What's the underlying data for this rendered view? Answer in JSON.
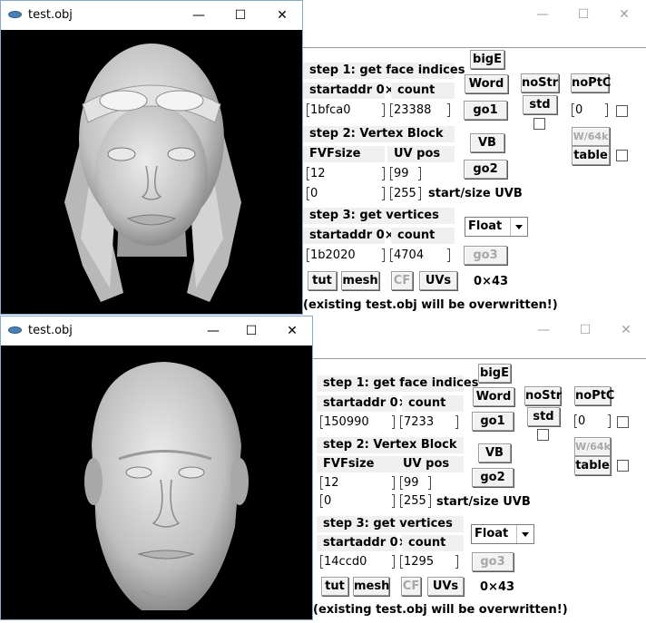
{
  "window1": {
    "viewer_title": "test.obj",
    "min": "—",
    "max": "☐",
    "close": "✕",
    "panel": {
      "min": "—",
      "max": "☐",
      "close": "✕",
      "step1": "step 1: get face indices",
      "startaddr_label": "startaddr 0×",
      "count_label": "count",
      "startaddr": "1bfca0",
      "count": "23388",
      "step2": "step 2: Vertex Block",
      "fvf_label": "FVFsize",
      "uvpos_label": "UV pos",
      "fvf": "12",
      "uvpos": "99",
      "uvstart": "0",
      "uvsize": "255",
      "uvb_label": "start/size UVB",
      "step3": "step 3: get vertices",
      "v_startaddr_label": "startaddr 0×",
      "v_count_label": "count",
      "v_startaddr": "1b2020",
      "v_count": "4704",
      "bigE": "bigE",
      "word": "Word",
      "go1": "go1",
      "vb": "VB",
      "go2": "go2",
      "go3": "go3",
      "noStr": "noStr",
      "std": "std",
      "noPtC": "noPtC",
      "w64": "W/64k",
      "table": "table",
      "ptc_value": "0",
      "float": "Float",
      "tut": "tut",
      "mesh": "mesh",
      "cf": "CF",
      "uvs": "UVs",
      "hex": "0×43",
      "warning": "(existing test.obj will be overwritten!)"
    }
  },
  "window2": {
    "viewer_title": "test.obj",
    "min": "—",
    "max": "☐",
    "close": "✕",
    "panel": {
      "min": "—",
      "max": "☐",
      "close": "✕",
      "step1": "step 1: get face indices",
      "startaddr_label": "startaddr 0×",
      "count_label": "count",
      "startaddr": "150990",
      "count": "7233",
      "step2": "step 2: Vertex Block",
      "fvf_label": "FVFsize",
      "uvpos_label": "UV pos",
      "fvf": "12",
      "uvpos": "99",
      "uvstart": "0",
      "uvsize": "255",
      "uvb_label": "start/size UVB",
      "step3": "step 3: get vertices",
      "v_startaddr_label": "startaddr 0×",
      "v_count_label": "count",
      "v_startaddr": "14ccd0",
      "v_count": "1295",
      "bigE": "bigE",
      "word": "Word",
      "go1": "go1",
      "vb": "VB",
      "go2": "go2",
      "go3": "go3",
      "noStr": "noStr",
      "std": "std",
      "noPtC": "noPtC",
      "w64": "W/64k",
      "table": "table",
      "ptc_value": "0",
      "float": "Float",
      "tut": "tut",
      "mesh": "mesh",
      "cf": "CF",
      "uvs": "UVs",
      "hex": "0×43",
      "warning": "(existing test.obj will be overwritten!)"
    }
  }
}
